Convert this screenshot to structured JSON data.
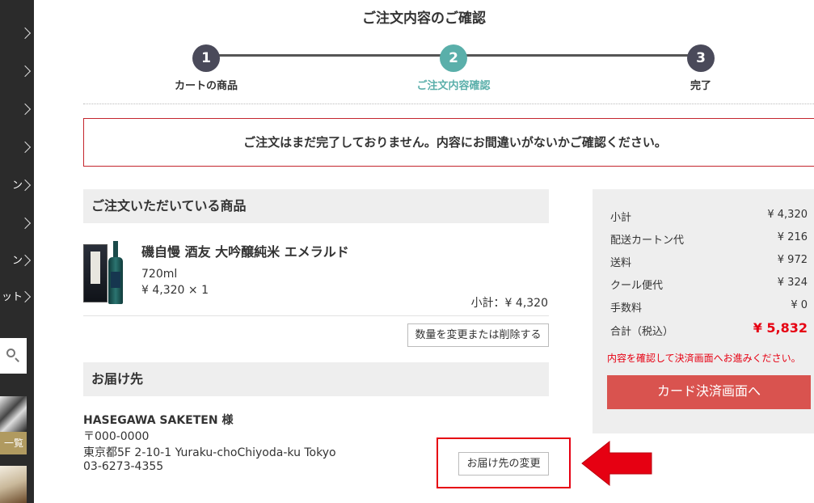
{
  "sidebar": {
    "items": [
      {
        "label": ""
      },
      {
        "label": ""
      },
      {
        "label": ""
      },
      {
        "label": ""
      },
      {
        "label": "ン"
      },
      {
        "label": ""
      },
      {
        "label": "ン"
      },
      {
        "label": "ット"
      }
    ],
    "badge": "一覧"
  },
  "page": {
    "title": "ご注文内容のご確認"
  },
  "stepper": {
    "steps": [
      {
        "num": "1",
        "label": "カートの商品"
      },
      {
        "num": "2",
        "label": "ご注文内容確認"
      },
      {
        "num": "3",
        "label": "完了"
      }
    ],
    "active_color": "#5aafaa",
    "inactive_color": "#4a4a5a"
  },
  "notice": "ご注文はまだ完了しておりません。内容にお間違いがないかご確認ください。",
  "order_items": {
    "heading": "ご注文いただいている商品",
    "product": {
      "name": "磯自慢 酒友 大吟醸純米 エメラルド",
      "volume": "720ml",
      "price_qty": "¥ 4,320 × 1",
      "subtotal": "小計：¥ 4,320"
    },
    "change_button": "数量を変更または削除する"
  },
  "delivery": {
    "heading": "お届け先",
    "name": "HASEGAWA SAKETEN 様",
    "postal": "〒000-0000",
    "address": "東京都5F 2-10-1 Yuraku-choChiyoda-ku Tokyo",
    "phone": "03-6273-4355",
    "change_button": "お届け先の変更"
  },
  "summary": {
    "rows": [
      {
        "label": "小計",
        "value": "¥ 4,320"
      },
      {
        "label": "配送カートン代",
        "value": "¥ 216"
      },
      {
        "label": "送料",
        "value": "¥ 972"
      },
      {
        "label": "クール便代",
        "value": "¥ 324"
      },
      {
        "label": "手数料",
        "value": "¥ 0"
      }
    ],
    "total": {
      "label": "合計（税込）",
      "value": "¥ 5,832"
    },
    "note": "内容を確認して決済画面へお進みください。",
    "pay_button": "カード決済画面へ"
  },
  "colors": {
    "accent": "#5aafaa",
    "error": "#e60012",
    "pay_button": "#d9534f"
  }
}
